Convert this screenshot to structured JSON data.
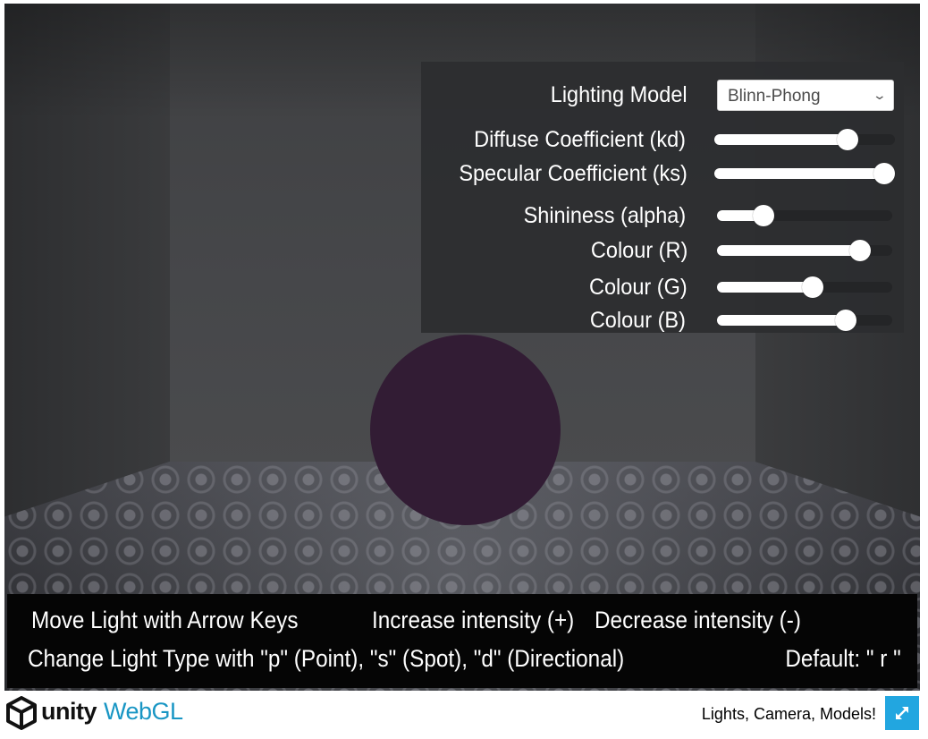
{
  "controls": {
    "lighting_model": {
      "label": "Lighting Model",
      "selected": "Blinn-Phong"
    },
    "sliders": [
      {
        "label": "Diffuse Coefficient (kd)",
        "value": 0.77
      },
      {
        "label": "Specular Coefficient (ks)",
        "value": 1.0
      },
      {
        "label": "Shininess (alpha)",
        "value": 0.23
      },
      {
        "label": "Colour (R)",
        "value": 0.86
      },
      {
        "label": "Colour (G)",
        "value": 0.55
      },
      {
        "label": "Colour (B)",
        "value": 0.77
      }
    ]
  },
  "instructions": {
    "move": "Move Light with Arrow Keys",
    "increase": "Increase intensity (+)",
    "decrease": "Decrease intensity (-)",
    "change_type": "Change Light Type with \"p\" (Point), \"s\" (Spot), \"d\" (Directional)",
    "default": "Default: \" r \""
  },
  "footer": {
    "unity_word": "unity",
    "webgl_word": "WebGL",
    "title": "Lights, Camera, Models!",
    "fullscreen_icon": "fullscreen-expand-icon"
  },
  "colors": {
    "sphere": "#321c34",
    "accent": "#22a6e0",
    "webgl_blue": "#1996c4"
  }
}
